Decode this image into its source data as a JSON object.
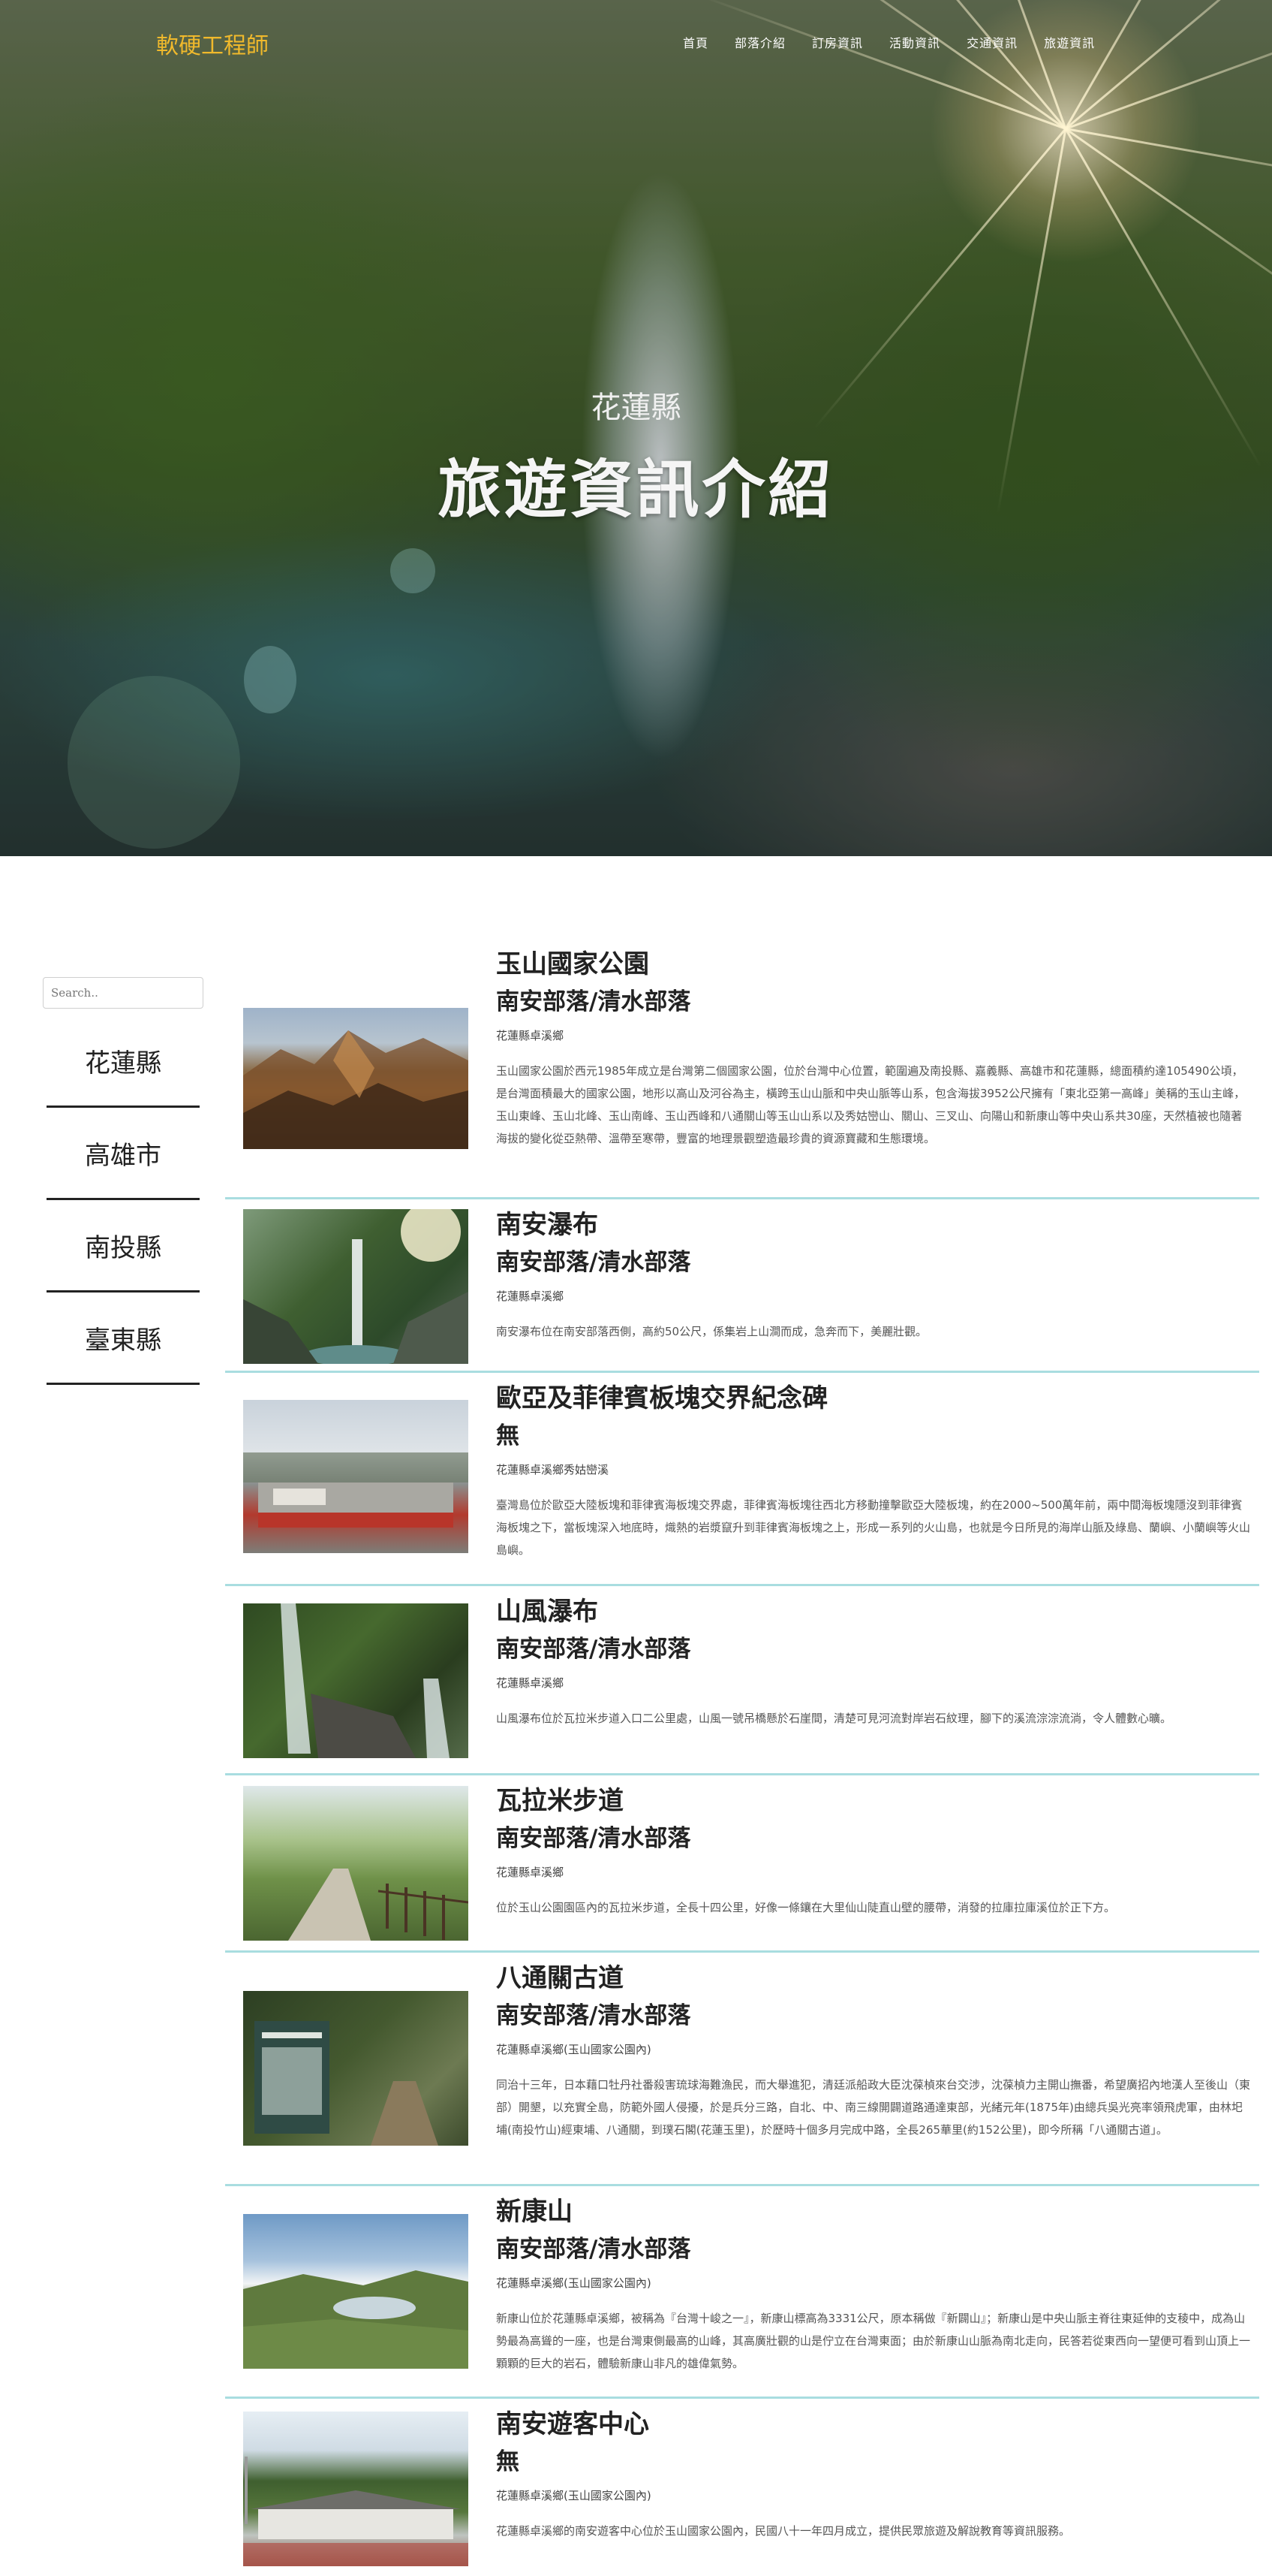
{
  "site": {
    "logo": "軟硬工程師",
    "nav": [
      "首頁",
      "部落介紹",
      "訂房資訊",
      "活動資訊",
      "交通資訊",
      "旅遊資訊"
    ]
  },
  "hero": {
    "subtitle": "花蓮縣",
    "title": "旅遊資訊介紹"
  },
  "sidebar": {
    "search_placeholder": "Search..",
    "items": [
      "花蓮縣",
      "高雄市",
      "南投縣",
      "臺東縣"
    ]
  },
  "entries": [
    {
      "title": "玉山國家公園",
      "tribe": "南安部落/清水部落",
      "location": "花蓮縣卓溪鄉",
      "body": "玉山國家公園於西元1985年成立是台灣第二個國家公園，位於台灣中心位置，範圍遍及南投縣、嘉義縣、高雄市和花蓮縣，總面積約達105490公頃，是台灣面積最大的國家公園，地形以高山及河谷為主，橫跨玉山山脈和中央山脈等山系，包含海拔3952公尺擁有「東北亞第一高峰」美稱的玉山主峰，玉山東峰、玉山北峰、玉山南峰、玉山西峰和八通關山等玉山山系以及秀姑巒山、關山、三叉山、向陽山和新康山等中央山系共30座，天然植被也隨著海拔的變化從亞熱帶、溫帶至寒帶，豐富的地理景觀塑造最珍貴的資源寶藏和生態環境。",
      "image_theme": "mountain-ridge"
    },
    {
      "title": "南安瀑布",
      "tribe": "南安部落/清水部落",
      "location": "花蓮縣卓溪鄉",
      "body": "南安瀑布位在南安部落西側，高約50公尺，係集岩上山澗而成，急奔而下，美麗壯觀。",
      "image_theme": "waterfall"
    },
    {
      "title": "歐亞及菲律賓板塊交界紀念碑",
      "tribe": "無",
      "location": "花蓮縣卓溪鄉秀姑巒溪",
      "body": "臺灣島位於歐亞大陸板塊和菲律賓海板塊交界處，菲律賓海板塊往西北方移動撞擊歐亞大陸板塊，約在2000~500萬年前，兩中間海板塊隱沒到菲律賓海板塊之下，當板塊深入地底時，熾熱的岩漿竄升到菲律賓海板塊之上，形成一系列的火山島，也就是今日所見的海岸山脈及綠島、蘭嶼、小蘭嶼等火山島嶼。",
      "image_theme": "monument"
    },
    {
      "title": "山風瀑布",
      "tribe": "南安部落/清水部落",
      "location": "花蓮縣卓溪鄉",
      "body": "山風瀑布位於瓦拉米步道入口二公里處，山風一號吊橋懸於石崖間，清楚可見河流對岸岩石紋理，腳下的溪流淙淙流淌，令人體數心曠。",
      "image_theme": "forest-falls"
    },
    {
      "title": "瓦拉米步道",
      "tribe": "南安部落/清水部落",
      "location": "花蓮縣卓溪鄉",
      "body": "位於玉山公園園區內的瓦拉米步道，全長十四公里，好像一條鑲在大里仙山陡直山壁的腰帶，消發的拉庫拉庫溪位於正下方。",
      "image_theme": "trail"
    },
    {
      "title": "八通關古道",
      "tribe": "南安部落/清水部落",
      "location": "花蓮縣卓溪鄉(玉山國家公園內)",
      "body": "同治十三年，日本藉口牡丹社番殺害琉球海難漁民，而大舉進犯，清廷派船政大臣沈葆楨來台交涉，沈葆楨力主開山撫番，希望廣招內地漢人至後山（東部）開墾，以充實全島，防範外國人侵擾，於是兵分三路，自北、中、南三線開闢道路通達東部，光緒元年(1875年)由總兵吳光亮率領飛虎軍，由林圯埔(南投竹山)經東埔、八通關，到璞石閣(花蓮玉里)，於歷時十個多月完成中路，全長265華里(約152公里)，即今所稱「八通關古道」。",
      "image_theme": "old-trail"
    },
    {
      "title": "新康山",
      "tribe": "南安部落/清水部落",
      "location": "花蓮縣卓溪鄉(玉山國家公園內)",
      "body": "新康山位於花蓮縣卓溪鄉，被稱為『台灣十峻之一』，新康山標高為3331公尺，原本稱做『新闢山』；新康山是中央山脈主脊往東延伸的支稜中，成為山勢最為高聳的一座，也是台灣東側最高的山峰，其高廣壯觀的山是佇立在台灣東面；由於新康山山脈為南北走向，民答若從東西向一望便可看到山頂上一顆顆的巨大的岩石，體驗新康山非凡的雄偉氣勢。",
      "image_theme": "alpine-lake"
    },
    {
      "title": "南安遊客中心",
      "tribe": "無",
      "location": "花蓮縣卓溪鄉(玉山國家公園內)",
      "body": "花蓮縣卓溪鄉的南安遊客中心位於玉山國家公園內，民國八十一年四月成立，提供民眾旅遊及解說教育等資訊服務。",
      "image_theme": "visitor-center"
    }
  ]
}
